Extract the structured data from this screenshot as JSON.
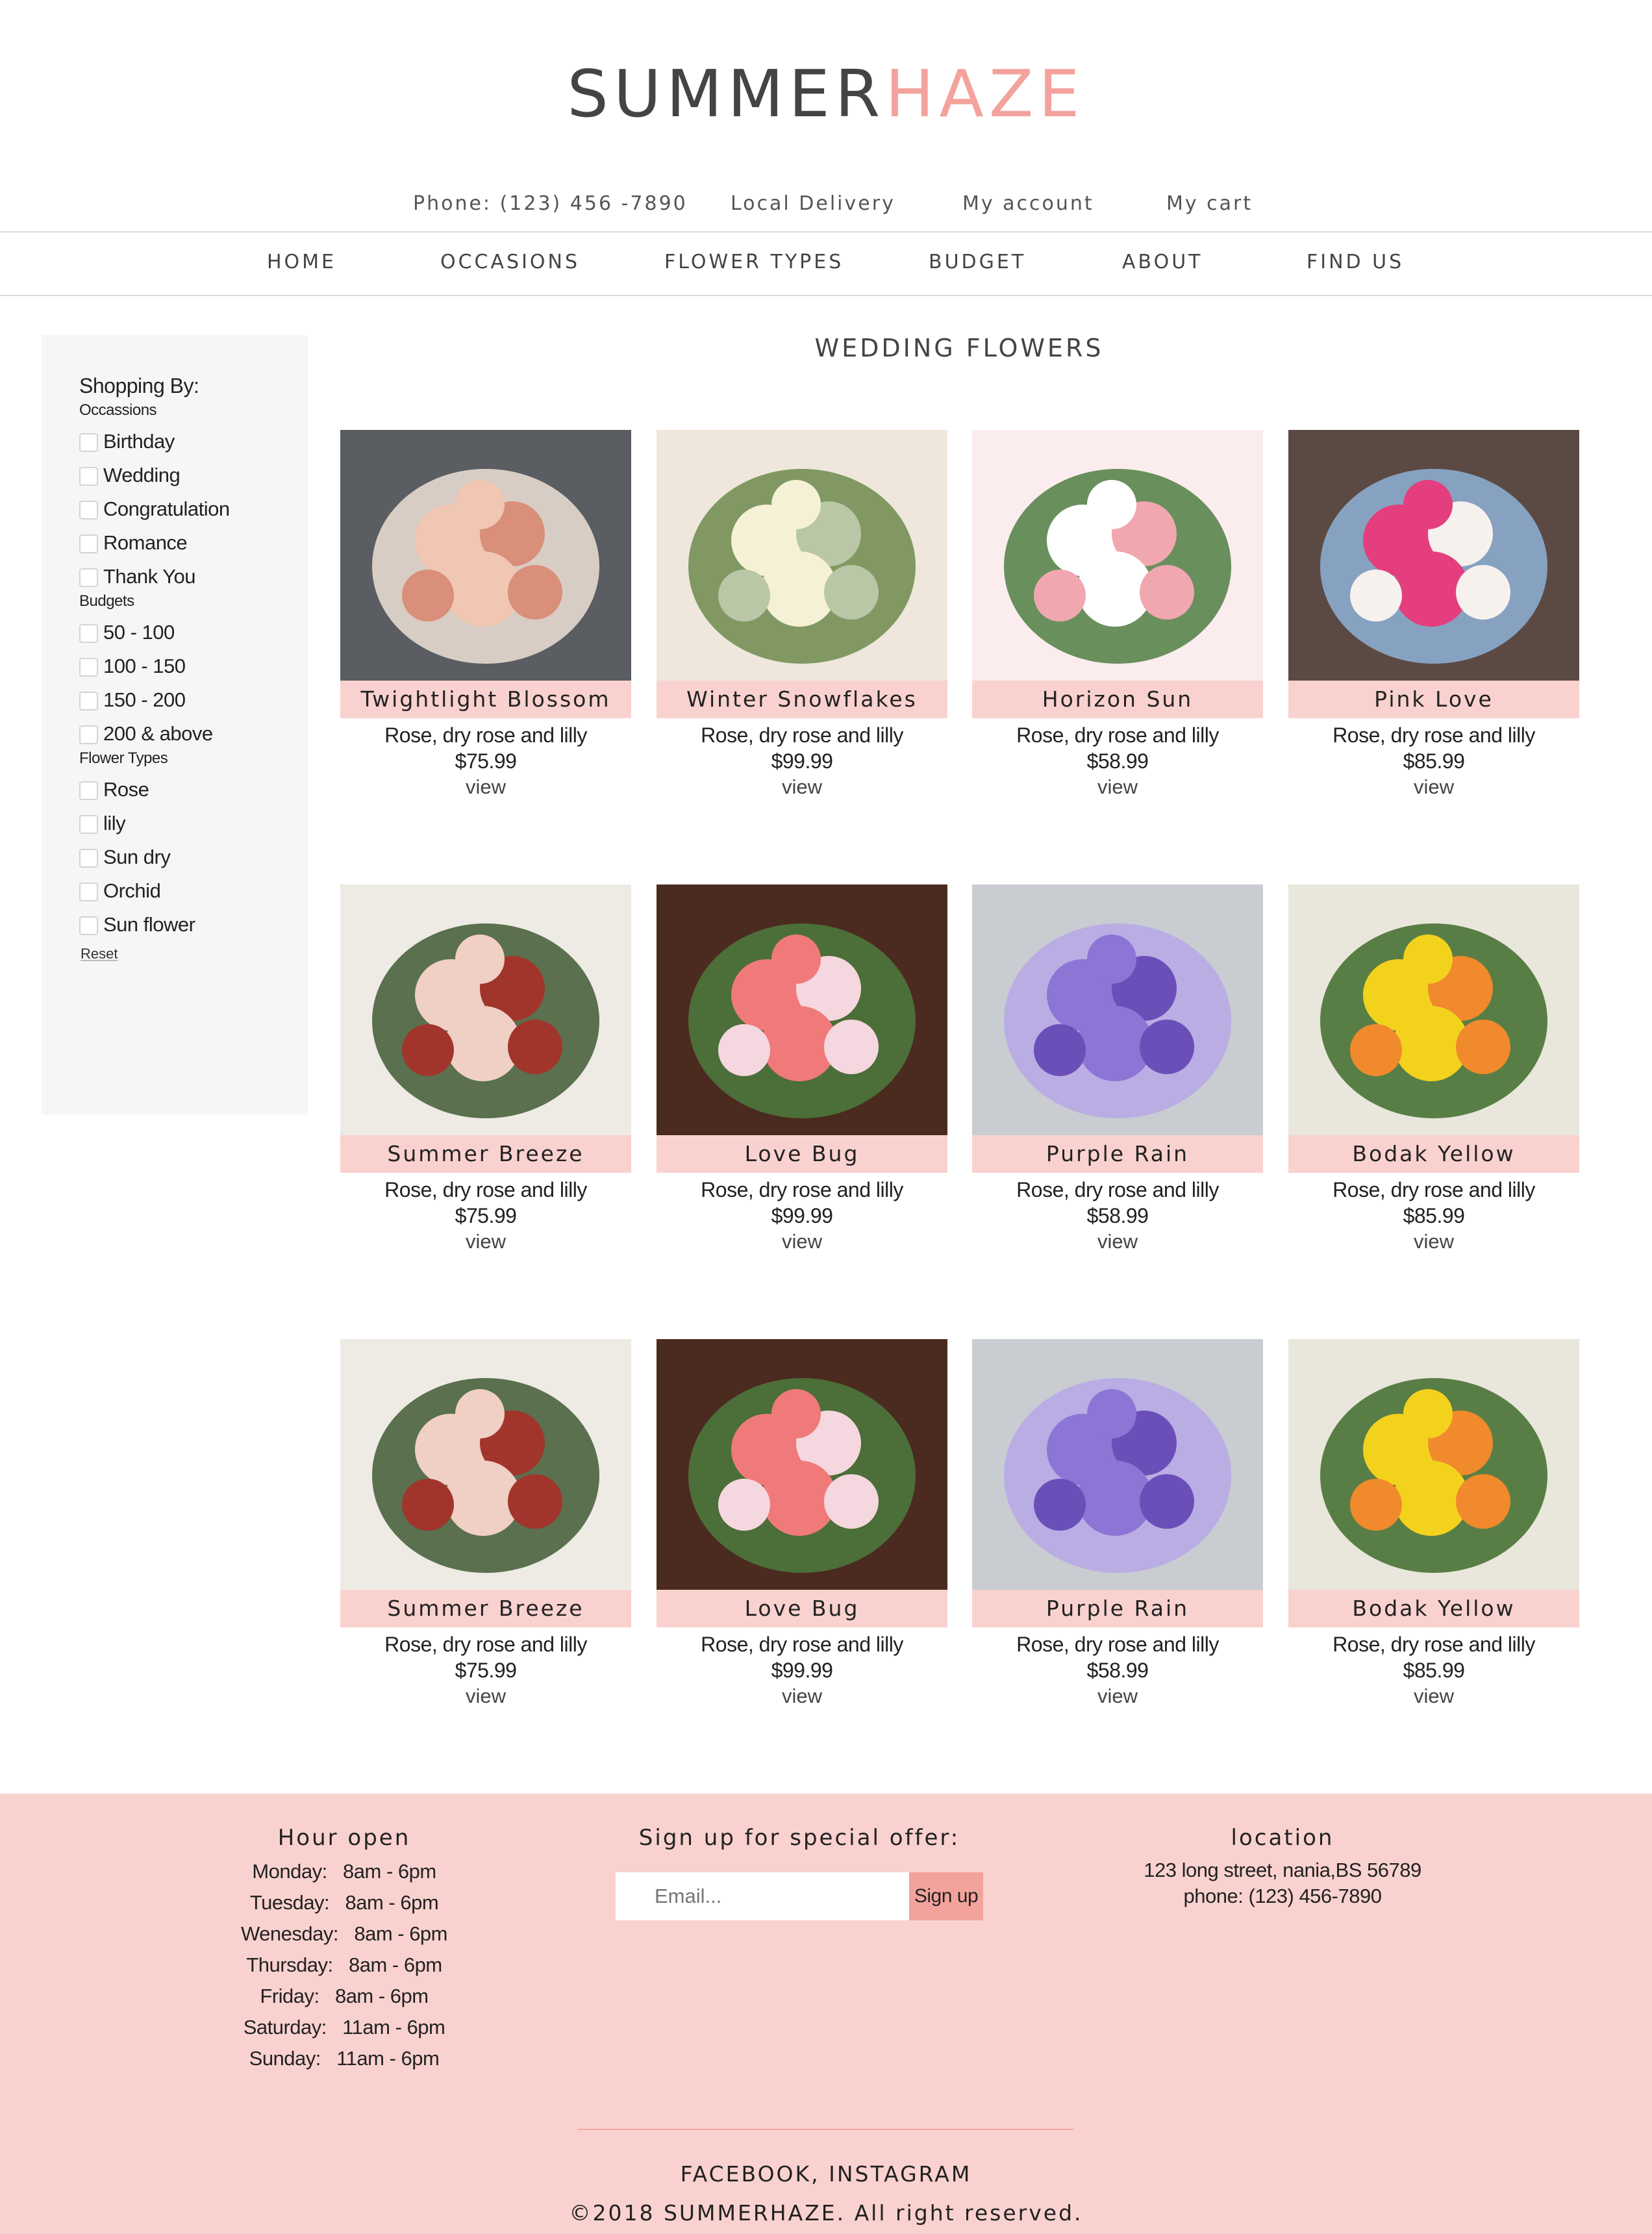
{
  "brand": {
    "part1": "SUMMER",
    "part2": "HAZE"
  },
  "top_links": [
    "Phone: (123) 456 -7890",
    "Local Delivery",
    "My account",
    "My cart"
  ],
  "nav": [
    "HOME",
    "OCCASIONS",
    "FLOWER TYPES",
    "BUDGET",
    "ABOUT",
    "FIND US"
  ],
  "sidebar": {
    "title": "Shopping By:",
    "occasions_label": "Occassions",
    "occasions": [
      "Birthday",
      "Wedding",
      "Congratulation",
      "Romance",
      "Thank You"
    ],
    "budgets_label": "Budgets",
    "budgets": [
      "50 - 100",
      "100 - 150",
      "150 - 200",
      "200 & above"
    ],
    "types_label": "Flower Types",
    "types": [
      "Rose",
      "lily",
      "Sun dry",
      "Orchid",
      "Sun flower"
    ],
    "reset": "Reset"
  },
  "main": {
    "title": "WEDDING FLOWERS",
    "products": [
      {
        "name": "Twightlight Blossom",
        "desc": "Rose, dry rose and lilly",
        "price": "$75.99",
        "view": "view"
      },
      {
        "name": "Winter Snowflakes",
        "desc": "Rose, dry rose and lilly",
        "price": "$99.99",
        "view": "view"
      },
      {
        "name": "Horizon Sun",
        "desc": "Rose, dry rose and lilly",
        "price": "$58.99",
        "view": "view"
      },
      {
        "name": "Pink Love",
        "desc": "Rose, dry rose and lilly",
        "price": "$85.99",
        "view": "view"
      },
      {
        "name": "Summer Breeze",
        "desc": "Rose, dry rose and lilly",
        "price": "$75.99",
        "view": "view"
      },
      {
        "name": "Love Bug",
        "desc": "Rose, dry rose and lilly",
        "price": "$99.99",
        "view": "view"
      },
      {
        "name": "Purple Rain",
        "desc": "Rose, dry rose and lilly",
        "price": "$58.99",
        "view": "view"
      },
      {
        "name": "Bodak Yellow",
        "desc": "Rose, dry rose and lilly",
        "price": "$85.99",
        "view": "view"
      },
      {
        "name": "Summer Breeze",
        "desc": "Rose, dry rose and lilly",
        "price": "$75.99",
        "view": "view"
      },
      {
        "name": "Love Bug",
        "desc": "Rose, dry rose and lilly",
        "price": "$99.99",
        "view": "view"
      },
      {
        "name": "Purple Rain",
        "desc": "Rose, dry rose and lilly",
        "price": "$58.99",
        "view": "view"
      },
      {
        "name": "Bodak Yellow",
        "desc": "Rose, dry rose and lilly",
        "price": "$85.99",
        "view": "view"
      }
    ]
  },
  "footer": {
    "hours_title": "Hour open",
    "hours": [
      "Monday:   8am - 6pm",
      "Tuesday:   8am - 6pm",
      "Wenesday:   8am - 6pm",
      "Thursday:   8am - 6pm",
      "Friday:   8am - 6pm",
      "Saturday:   11am - 6pm",
      "Sunday:   11am - 6pm"
    ],
    "signup_title": "Sign up for special offer:",
    "email_placeholder": "Email...",
    "signup_button": "Sign up",
    "location_title": "location",
    "address": "123 long street, nania,BS 56789",
    "phone": "phone: (123) 456-7890",
    "social": "FACEBOOK, INSTAGRAM",
    "copyright": "©2018 SUMMERHAZE. All right reserved."
  },
  "colors": {
    "accent": "#f3a29c",
    "pink_band": "#f9d2cf",
    "sidebar_bg": "#f6f6f6"
  }
}
